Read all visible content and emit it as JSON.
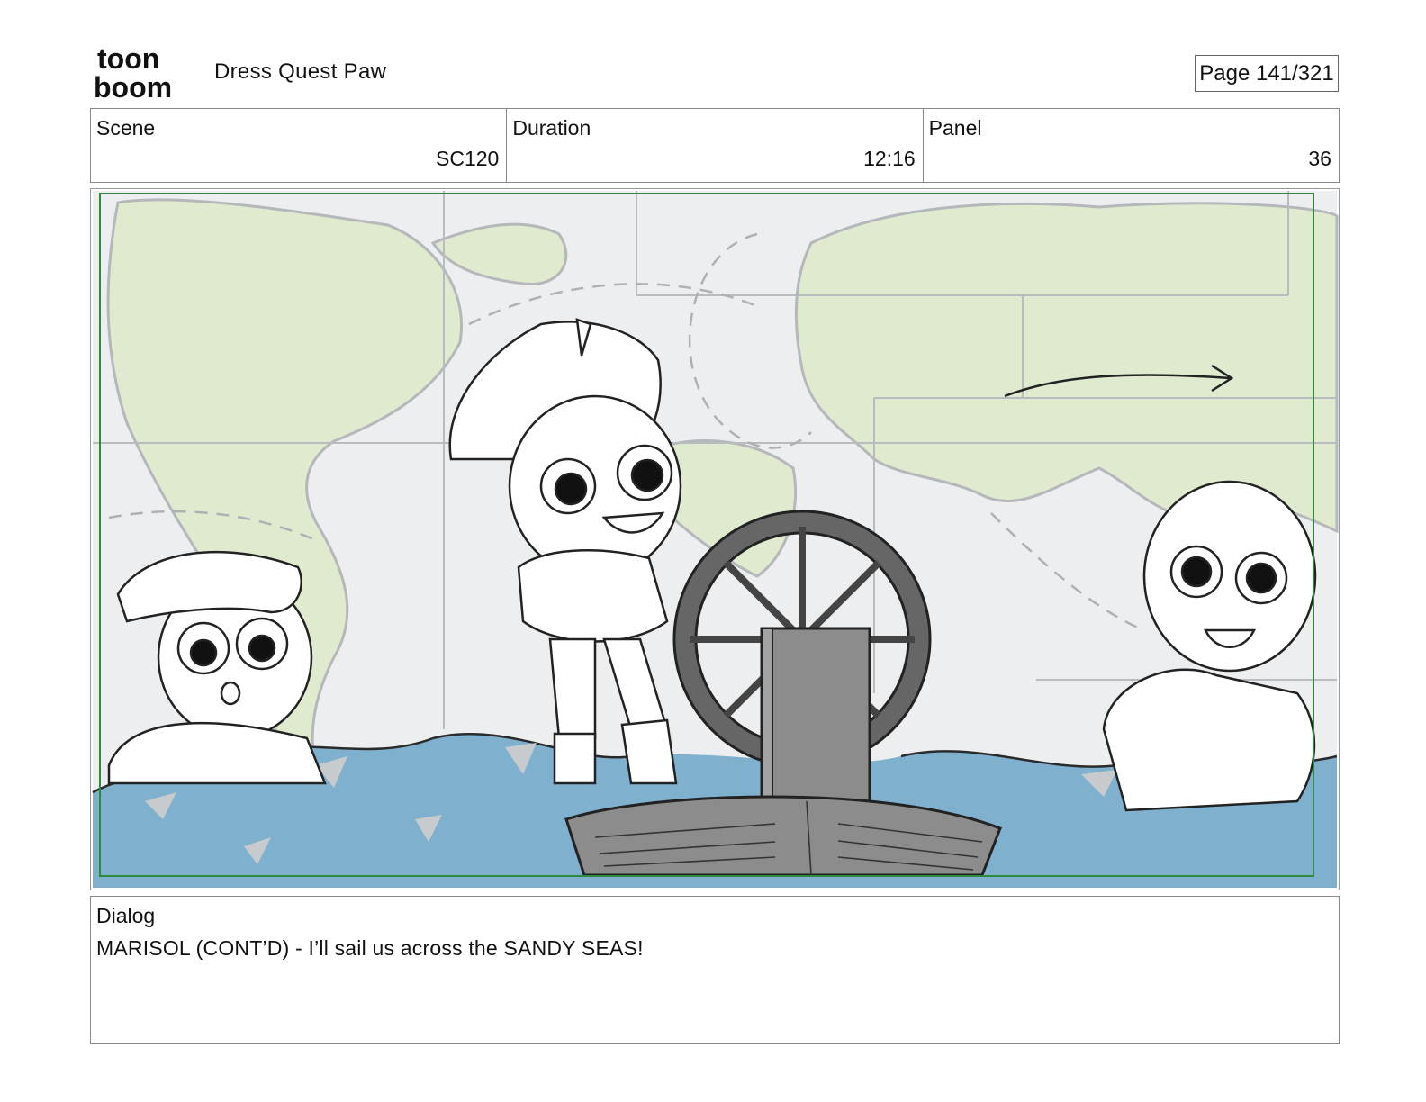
{
  "logo": {
    "line1": "toon",
    "line2": "boom"
  },
  "project_title": "Dress Quest Paw",
  "page": "Page 141/321",
  "info": {
    "scene_label": "Scene",
    "scene_value": "SC120",
    "duration_label": "Duration",
    "duration_value": "12:16",
    "panel_label": "Panel",
    "panel_value": "36"
  },
  "panel_image": {
    "icon": "storyboard-panel-image",
    "colors": {
      "map_land": "#dfeacf",
      "map_bg": "#eceef0",
      "water": "#7fb1cf",
      "frame_green": "#2e8b3e",
      "boat": "#8c8c8c"
    }
  },
  "dialog": {
    "label": "Dialog",
    "text": "MARISOL (CONT’D) - I’ll sail us across the SANDY SEAS!"
  }
}
